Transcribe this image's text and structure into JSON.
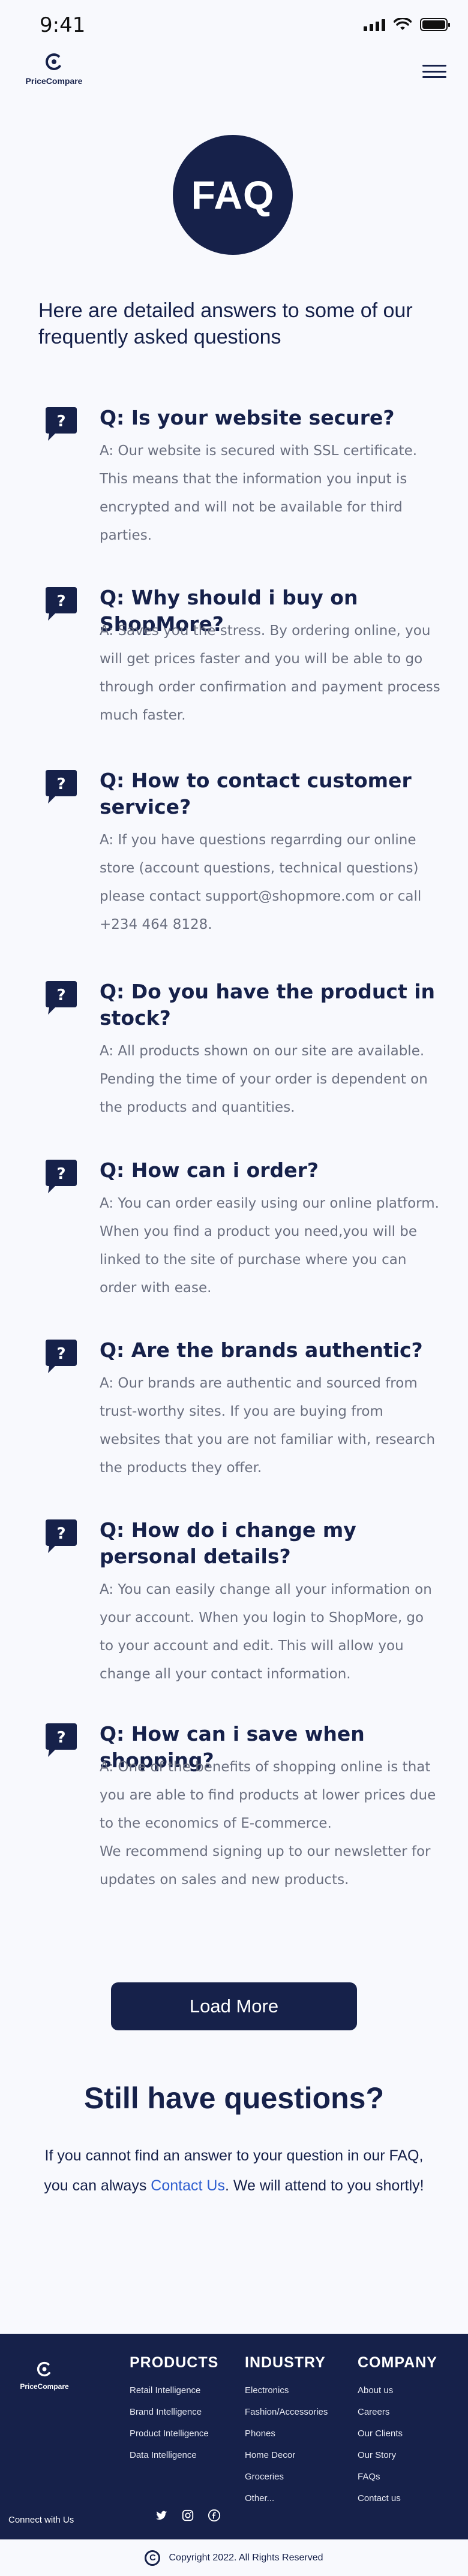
{
  "status_bar": {
    "time": "9:41"
  },
  "header": {
    "logo_text": "PriceCompare"
  },
  "hero": {
    "badge": "FAQ",
    "intro": "Here are detailed answers to some of our frequently asked questions"
  },
  "faqs": [
    {
      "question": "Q: Is your website secure?",
      "answer": "A: Our website is secured with SSL certificate. This means that the information you input is encrypted and will not be available for third parties."
    },
    {
      "question": "Q: Why should i buy on ShopMore?",
      "answer": "A: Saves you the stress. By ordering online, you will get prices faster and you will be able to go through order confirmation and payment process much faster."
    },
    {
      "question": "Q: How to contact customer service?",
      "answer": "A: If you have questions regarrding our online store (account questions, technical questions) please contact support@shopmore.com or call +234 464 8128."
    },
    {
      "question": "Q: Do you have the product in stock?",
      "answer": "A: All products shown on our site are available. Pending the time of your order is dependent on the products and quantities."
    },
    {
      "question": "Q: How can i order?",
      "answer": "A: You can order easily using our online platform. When you find a product you need,you will be linked to the site of purchase where you can order with ease."
    },
    {
      "question": "Q: Are the brands authentic?",
      "answer": "A: Our brands are authentic and sourced from trust-worthy sites. If you are buying from websites that you are not familiar with, research the products they offer."
    },
    {
      "question": "Q: How do i change my personal details?",
      "answer": "A: You can easily change all your information on your account. When you login to ShopMore, go to your account and edit. This will allow you change all your contact information."
    },
    {
      "question": "Q: How can i save when shopping?",
      "answer": "A: One of the benefits of shopping online is that you are able to find products at lower prices due to the economics of  E-commerce.",
      "answer_extra": " We recommend signing up to our newsletter for updates on sales and new products."
    }
  ],
  "load_more": "Load More",
  "still": {
    "title": "Still have questions?",
    "text_before": "If you cannot find an answer to your question in our FAQ, you can always ",
    "link": "Contact Us",
    "text_after": ". We will attend to you shortly!"
  },
  "footer": {
    "logo_text": "PriceCompare",
    "products": {
      "heading": "PRODUCTS",
      "links": [
        "Retail Intelligence",
        "Brand Intelligence",
        "Product Intelligence",
        "Data Intelligence"
      ]
    },
    "industry": {
      "heading": "INDUSTRY",
      "links": [
        "Electronics",
        "Fashion/Accessories",
        "Phones",
        "Home Decor",
        "Groceries",
        "Other..."
      ]
    },
    "company": {
      "heading": "COMPANY",
      "links": [
        "About us",
        "Careers",
        "Our Clients",
        "Our Story",
        "FAQs",
        "Contact us"
      ]
    },
    "connect": "Connect with Us",
    "social_icons": [
      "twitter-icon",
      "instagram-icon",
      "facebook-icon"
    ]
  },
  "copyright": {
    "symbol": "C",
    "text": "Copyright 2022. All Rights Reserved"
  },
  "colors": {
    "primary": "#16214a",
    "background": "#f8f9fd",
    "answer_text": "#6b7080",
    "link": "#2f5fd0"
  }
}
